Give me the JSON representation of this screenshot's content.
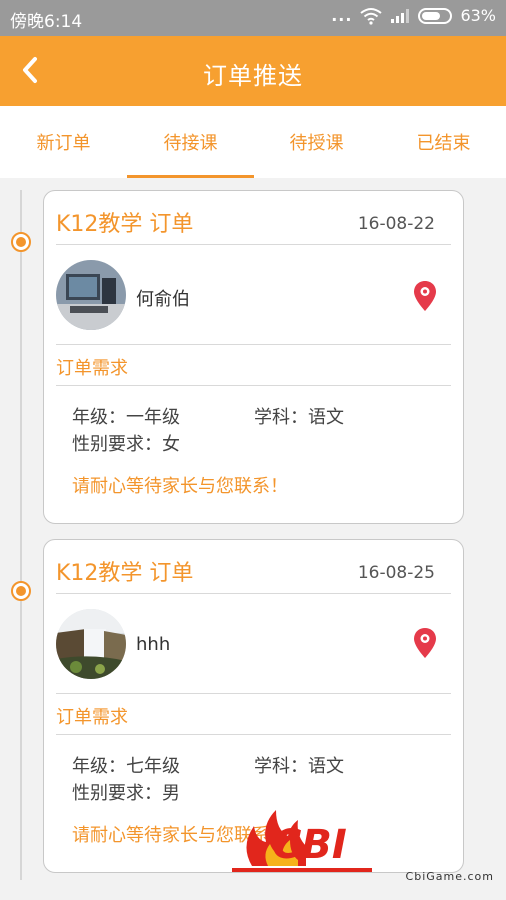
{
  "status_bar": {
    "time": "傍晚6:14",
    "dots": "...",
    "battery": "63%"
  },
  "header": {
    "title": "订单推送",
    "back_icon": "chevron-left-icon",
    "background": "#f7a030"
  },
  "tabs": [
    {
      "label": "新订单",
      "active": false
    },
    {
      "label": "待接课",
      "active": true
    },
    {
      "label": "待授课",
      "active": false
    },
    {
      "label": "已结束",
      "active": false
    }
  ],
  "orders": [
    {
      "title": "K12教学 订单",
      "date": "16-08-22",
      "name": "何俞伯",
      "requirements_label": "订单需求",
      "grade": "年级：一年级",
      "subject": "学科：语文",
      "gender": "性别要求：女",
      "waiting_text": "请耐心等待家长与您联系！"
    },
    {
      "title": "K12教学 订单",
      "date": "16-08-25",
      "name": "hhh",
      "requirements_label": "订单需求",
      "grade": "年级：七年级",
      "subject": "学科：语文",
      "gender": "性别要求：男",
      "waiting_text": "请耐心等待家长与您联系！"
    }
  ],
  "watermark": {
    "logo": "CBI",
    "site": "CbiGame.com"
  },
  "colors": {
    "accent": "#f3952c",
    "status_bar": "#9a9a9a",
    "pin": "#e53a4a"
  }
}
